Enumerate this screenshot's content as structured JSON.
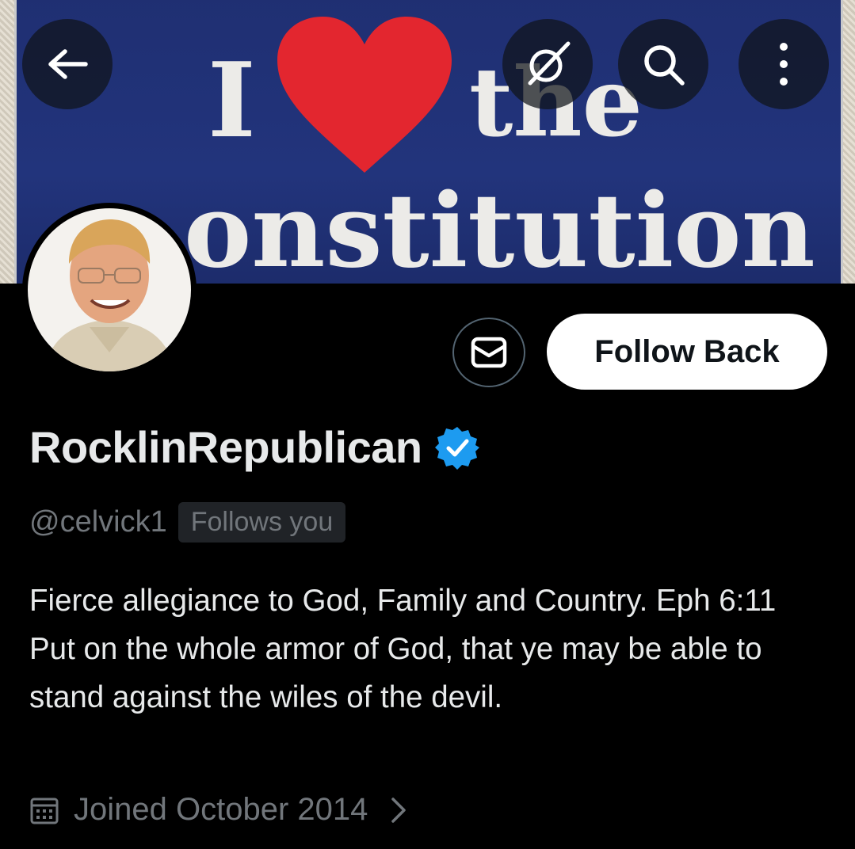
{
  "banner": {
    "word_i": "I",
    "word_the": "the",
    "word_constitution": "onstitution"
  },
  "header": {
    "back_icon": "arrow-left-icon",
    "grok_icon": "grok-icon",
    "search_icon": "search-icon",
    "more_icon": "more-vertical-icon"
  },
  "profile": {
    "display_name": "RocklinRepublican",
    "verified": true,
    "handle": "@celvick1",
    "follows_badge": "Follows you",
    "bio": "Fierce allegiance to God, Family and Country. Eph 6:11 Put on the whole armor of God, that ye may be able to stand against the wiles of the devil.",
    "joined": "Joined October 2014"
  },
  "actions": {
    "follow_label": "Follow Back",
    "message_icon": "envelope-icon"
  },
  "colors": {
    "background": "#000000",
    "verified_blue": "#1d9bf0",
    "secondary_text": "#71767b",
    "button_bg": "#ffffff"
  }
}
